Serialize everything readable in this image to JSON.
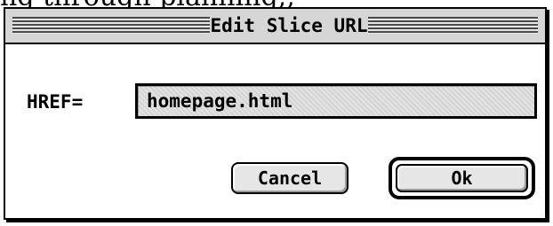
{
  "page_text_above": "ng through planning,,",
  "dialog": {
    "title": "Edit Slice URL",
    "href_label": "HREF=",
    "href_value": "homepage.html",
    "cancel_label": "Cancel",
    "ok_label": "Ok"
  },
  "colors": {
    "title_bar": "#d6d6d6",
    "button_face": "#e6e6e6",
    "field_fill": "#dcdcdc"
  }
}
